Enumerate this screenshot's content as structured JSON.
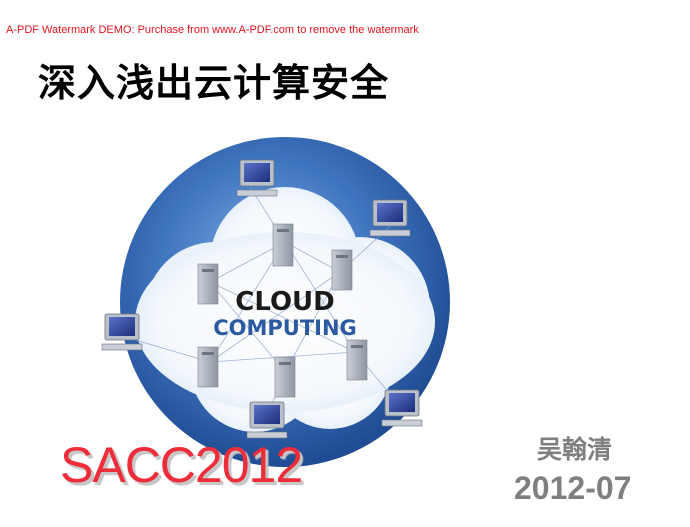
{
  "slide": {
    "watermark": "A-PDF Watermark DEMO: Purchase from www.A-PDF.com to remove the watermark",
    "title": "深入浅出云计算安全",
    "illustration": {
      "line1": "CLOUD",
      "line2": "COMPUTING"
    },
    "event": "SACC2012",
    "author": "吴翰清",
    "date": "2012-07"
  },
  "colors": {
    "watermark": "#e0141e",
    "event": "#ee2d3a",
    "author_date": "#7f7f7f",
    "globe": "#2f5fa8"
  }
}
